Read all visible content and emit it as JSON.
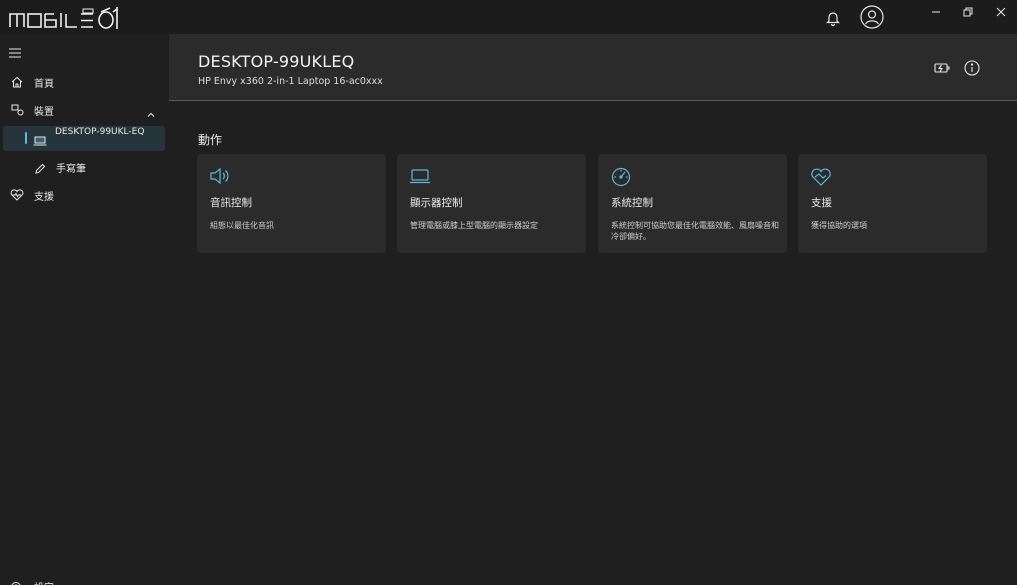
{
  "app": {
    "logo_text": "MOBILE01"
  },
  "window": {
    "controls": [
      "minimize",
      "restore",
      "close"
    ]
  },
  "sidebar": {
    "items": [
      {
        "label": "首頁",
        "icon": "home-icon"
      },
      {
        "label": "裝置",
        "icon": "devices-icon",
        "expanded": true
      },
      {
        "label": "DESKTOP-99UKL-EQ",
        "icon": "laptop-icon",
        "selected": true
      },
      {
        "label": "手寫筆",
        "icon": "pen-icon"
      },
      {
        "label": "支援",
        "icon": "support-heart-icon"
      }
    ],
    "bottom_label": "設定"
  },
  "header": {
    "device_name": "DESKTOP-99UKLEQ",
    "model": "HP Envy x360 2-in-1 Laptop 16-ac0xxx"
  },
  "actions": {
    "title": "動作",
    "cards": [
      {
        "icon": "speaker-icon",
        "title": "音訊控制",
        "description": "組態以最佳化音訊"
      },
      {
        "icon": "display-icon",
        "title": "顯示器控制",
        "description": "管理電腦或膝上型電腦的顯示器設定"
      },
      {
        "icon": "gauge-icon",
        "title": "系統控制",
        "description": "系統控制可協助您最佳化電腦效能、風扇噪音和冷卻偏好。"
      },
      {
        "icon": "support-heart-icon",
        "title": "支援",
        "description": "獲得協助的選項"
      }
    ]
  },
  "colors": {
    "accent": "#5fb8d8",
    "background": "#1f1f1f",
    "card": "#2b2b2b",
    "selected": "#26343b"
  }
}
